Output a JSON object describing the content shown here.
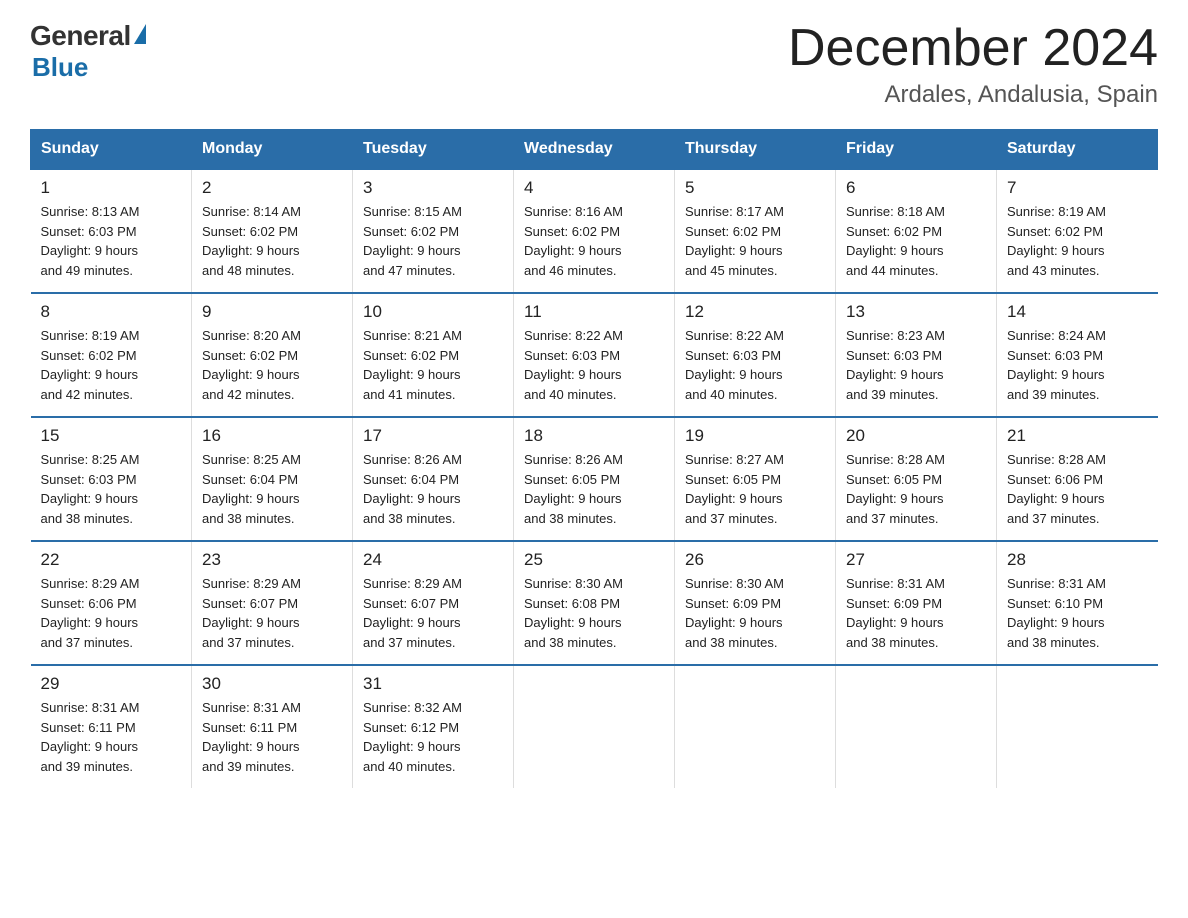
{
  "header": {
    "logo_general": "General",
    "logo_blue": "Blue",
    "month": "December 2024",
    "location": "Ardales, Andalusia, Spain"
  },
  "weekdays": [
    "Sunday",
    "Monday",
    "Tuesday",
    "Wednesday",
    "Thursday",
    "Friday",
    "Saturday"
  ],
  "weeks": [
    [
      {
        "day": "1",
        "sunrise": "8:13 AM",
        "sunset": "6:03 PM",
        "daylight": "9 hours and 49 minutes."
      },
      {
        "day": "2",
        "sunrise": "8:14 AM",
        "sunset": "6:02 PM",
        "daylight": "9 hours and 48 minutes."
      },
      {
        "day": "3",
        "sunrise": "8:15 AM",
        "sunset": "6:02 PM",
        "daylight": "9 hours and 47 minutes."
      },
      {
        "day": "4",
        "sunrise": "8:16 AM",
        "sunset": "6:02 PM",
        "daylight": "9 hours and 46 minutes."
      },
      {
        "day": "5",
        "sunrise": "8:17 AM",
        "sunset": "6:02 PM",
        "daylight": "9 hours and 45 minutes."
      },
      {
        "day": "6",
        "sunrise": "8:18 AM",
        "sunset": "6:02 PM",
        "daylight": "9 hours and 44 minutes."
      },
      {
        "day": "7",
        "sunrise": "8:19 AM",
        "sunset": "6:02 PM",
        "daylight": "9 hours and 43 minutes."
      }
    ],
    [
      {
        "day": "8",
        "sunrise": "8:19 AM",
        "sunset": "6:02 PM",
        "daylight": "9 hours and 42 minutes."
      },
      {
        "day": "9",
        "sunrise": "8:20 AM",
        "sunset": "6:02 PM",
        "daylight": "9 hours and 42 minutes."
      },
      {
        "day": "10",
        "sunrise": "8:21 AM",
        "sunset": "6:02 PM",
        "daylight": "9 hours and 41 minutes."
      },
      {
        "day": "11",
        "sunrise": "8:22 AM",
        "sunset": "6:03 PM",
        "daylight": "9 hours and 40 minutes."
      },
      {
        "day": "12",
        "sunrise": "8:22 AM",
        "sunset": "6:03 PM",
        "daylight": "9 hours and 40 minutes."
      },
      {
        "day": "13",
        "sunrise": "8:23 AM",
        "sunset": "6:03 PM",
        "daylight": "9 hours and 39 minutes."
      },
      {
        "day": "14",
        "sunrise": "8:24 AM",
        "sunset": "6:03 PM",
        "daylight": "9 hours and 39 minutes."
      }
    ],
    [
      {
        "day": "15",
        "sunrise": "8:25 AM",
        "sunset": "6:03 PM",
        "daylight": "9 hours and 38 minutes."
      },
      {
        "day": "16",
        "sunrise": "8:25 AM",
        "sunset": "6:04 PM",
        "daylight": "9 hours and 38 minutes."
      },
      {
        "day": "17",
        "sunrise": "8:26 AM",
        "sunset": "6:04 PM",
        "daylight": "9 hours and 38 minutes."
      },
      {
        "day": "18",
        "sunrise": "8:26 AM",
        "sunset": "6:05 PM",
        "daylight": "9 hours and 38 minutes."
      },
      {
        "day": "19",
        "sunrise": "8:27 AM",
        "sunset": "6:05 PM",
        "daylight": "9 hours and 37 minutes."
      },
      {
        "day": "20",
        "sunrise": "8:28 AM",
        "sunset": "6:05 PM",
        "daylight": "9 hours and 37 minutes."
      },
      {
        "day": "21",
        "sunrise": "8:28 AM",
        "sunset": "6:06 PM",
        "daylight": "9 hours and 37 minutes."
      }
    ],
    [
      {
        "day": "22",
        "sunrise": "8:29 AM",
        "sunset": "6:06 PM",
        "daylight": "9 hours and 37 minutes."
      },
      {
        "day": "23",
        "sunrise": "8:29 AM",
        "sunset": "6:07 PM",
        "daylight": "9 hours and 37 minutes."
      },
      {
        "day": "24",
        "sunrise": "8:29 AM",
        "sunset": "6:07 PM",
        "daylight": "9 hours and 37 minutes."
      },
      {
        "day": "25",
        "sunrise": "8:30 AM",
        "sunset": "6:08 PM",
        "daylight": "9 hours and 38 minutes."
      },
      {
        "day": "26",
        "sunrise": "8:30 AM",
        "sunset": "6:09 PM",
        "daylight": "9 hours and 38 minutes."
      },
      {
        "day": "27",
        "sunrise": "8:31 AM",
        "sunset": "6:09 PM",
        "daylight": "9 hours and 38 minutes."
      },
      {
        "day": "28",
        "sunrise": "8:31 AM",
        "sunset": "6:10 PM",
        "daylight": "9 hours and 38 minutes."
      }
    ],
    [
      {
        "day": "29",
        "sunrise": "8:31 AM",
        "sunset": "6:11 PM",
        "daylight": "9 hours and 39 minutes."
      },
      {
        "day": "30",
        "sunrise": "8:31 AM",
        "sunset": "6:11 PM",
        "daylight": "9 hours and 39 minutes."
      },
      {
        "day": "31",
        "sunrise": "8:32 AM",
        "sunset": "6:12 PM",
        "daylight": "9 hours and 40 minutes."
      },
      null,
      null,
      null,
      null
    ]
  ]
}
